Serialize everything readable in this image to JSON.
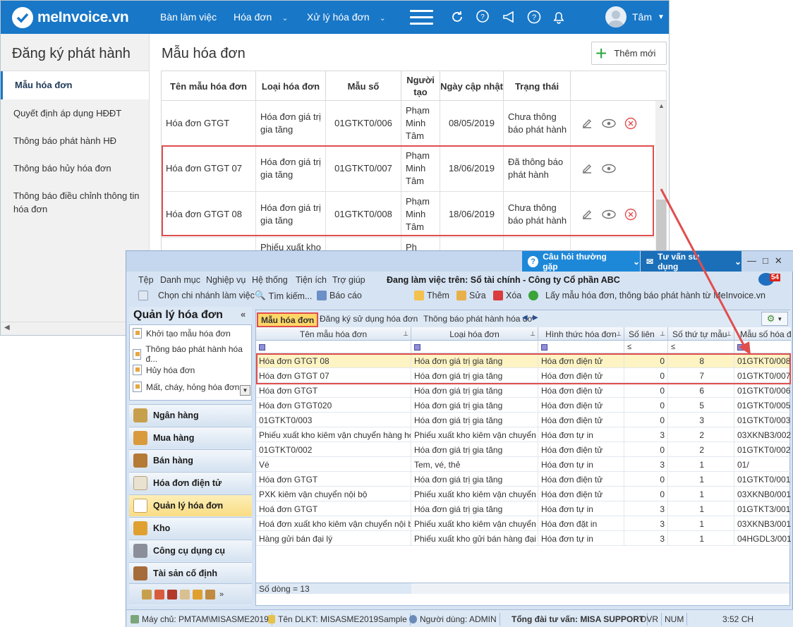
{
  "web": {
    "logo_text": "meInvoice.vn",
    "nav": [
      "Bàn làm việc",
      "Hóa đơn",
      "Xử lý hóa đơn"
    ],
    "user": "Tâm",
    "sidebar": {
      "title": "Đăng ký phát hành",
      "items": [
        "Mẫu hóa đơn",
        "Quyết định áp dụng HĐĐT",
        "Thông báo phát hành HĐ",
        "Thông báo hủy hóa đơn",
        "Thông báo điều chỉnh thông tin hóa đơn"
      ]
    },
    "page_title": "Mẫu hóa đơn",
    "add_button": "Thêm mới",
    "table": {
      "headers": [
        "Tên mẫu hóa đơn",
        "Loại hóa đơn",
        "Mẫu số",
        "Người tạo",
        "Ngày cập nhật",
        "Trạng thái"
      ],
      "rows": [
        {
          "name": "Hóa đơn GTGT",
          "type": "Hóa đơn giá trị gia tăng",
          "code": "01GTKT0/006",
          "creator": "Phạm Minh Tâm",
          "date": "08/05/2019",
          "status": "Chưa thông báo phát hành"
        },
        {
          "name": "Hóa đơn GTGT 07",
          "type": "Hóa đơn giá trị gia tăng",
          "code": "01GTKT0/007",
          "creator": "Phạm Minh Tâm",
          "date": "18/06/2019",
          "status": "Đã thông báo phát hành"
        },
        {
          "name": "Hóa đơn GTGT 08",
          "type": "Hóa đơn giá trị gia tăng",
          "code": "01GTKT0/008",
          "creator": "Phạm Minh Tâm",
          "date": "18/06/2019",
          "status": "Chưa thông báo phát hành"
        },
        {
          "name": "",
          "type": "Phiếu xuất kho",
          "code": "",
          "creator": "Ph",
          "date": "",
          "status": ""
        }
      ]
    }
  },
  "desktop": {
    "faq": "Câu hỏi thường gặp",
    "support": "Tư vấn sử dụng",
    "menu": [
      "Tệp",
      "Danh mục",
      "Nghiệp vụ",
      "Hệ thống",
      "Tiện ích",
      "Trợ giúp"
    ],
    "working_on": "Đang làm việc trên: Sổ tài chính - Công ty Cổ phần ABC",
    "badge": "54",
    "toolbar": [
      "Chọn chi nhánh làm việc",
      "Tìm kiếm...",
      "Báo cáo",
      "Thêm",
      "Sửa",
      "Xóa",
      "Lấy mẫu hóa đơn, thông báo phát hành từ MeInvoice.vn"
    ],
    "left_title": "Quản lý hóa đơn",
    "left_list": [
      "Khởi tạo mẫu hóa đơn",
      "Thông báo phát hành hóa đ...",
      "Hủy hóa đơn",
      "Mất, cháy, hỏng hóa đơn"
    ],
    "modules": [
      "Ngân hàng",
      "Mua hàng",
      "Bán hàng",
      "Hóa đơn điện tử",
      "Quản lý hóa đơn",
      "Kho",
      "Công cụ dụng cụ",
      "Tài sản cố định"
    ],
    "tabs": [
      "Mẫu hóa đơn",
      "Đăng ký sử dụng hóa đơn",
      "Thông báo phát hành hóa đơ"
    ],
    "grid_headers": [
      "Tên mẫu hóa đơn",
      "Loại hóa đơn",
      "Hình thức hóa đơn",
      "Số liên",
      "Số thứ tự mẫu",
      "Mẫu số hóa đơ"
    ],
    "filter_ops": [
      "≤",
      "≤"
    ],
    "grid_rows": [
      [
        "Hóa đơn GTGT 08",
        "Hóa đơn giá trị gia tăng",
        "Hóa đơn điện tử",
        "0",
        "8",
        "01GTKT0/008"
      ],
      [
        "Hóa đơn GTGT 07",
        "Hóa đơn giá trị gia tăng",
        "Hóa đơn điện tử",
        "0",
        "7",
        "01GTKT0/007"
      ],
      [
        "Hóa đơn GTGT",
        "Hóa đơn giá trị gia tăng",
        "Hóa đơn điện tử",
        "0",
        "6",
        "01GTKT0/006"
      ],
      [
        "Hóa đơn GTGT020",
        "Hóa đơn giá trị gia tăng",
        "Hóa đơn điện tử",
        "0",
        "5",
        "01GTKT0/005"
      ],
      [
        "01GTKT0/003",
        "Hóa đơn giá trị gia tăng",
        "Hóa đơn điện tử",
        "0",
        "3",
        "01GTKT0/003"
      ],
      [
        "Phiếu xuất kho kiêm vận chuyển hàng hó",
        "Phiếu xuất kho kiêm vận chuyển",
        "Hóa đơn tự in",
        "3",
        "2",
        "03XKNB3/002"
      ],
      [
        "01GTKT0/002",
        "Hóa đơn giá trị gia tăng",
        "Hóa đơn điện tử",
        "0",
        "2",
        "01GTKT0/002"
      ],
      [
        "Vé",
        "Tem, vé, thẻ",
        "Hóa đơn tự in",
        "3",
        "1",
        "01/"
      ],
      [
        "Hóa đơn GTGT",
        "Hóa đơn giá trị gia tăng",
        "Hóa đơn điện tử",
        "0",
        "1",
        "01GTKT0/001"
      ],
      [
        "PXK kiêm vận chuyển nội bộ",
        "Phiếu xuất kho kiêm vận chuyển",
        "Hóa đơn điện tử",
        "0",
        "1",
        "03XKNB0/001"
      ],
      [
        "Hoá đơn GTGT",
        "Hóa đơn giá trị gia tăng",
        "Hóa đơn tự in",
        "3",
        "1",
        "01GTKT3/001"
      ],
      [
        "Hoá đơn xuất kho kiêm vận chuyển nội bộ",
        "Phiếu xuất kho kiêm vận chuyển",
        "Hóa đơn đặt in",
        "3",
        "1",
        "03XKNB3/001"
      ],
      [
        "Hàng gửi bán đại lý",
        "Phiếu xuất kho gửi bán hàng đại l",
        "Hóa đơn tự in",
        "3",
        "1",
        "04HGDL3/001"
      ]
    ],
    "row_count": "Số dòng = 13",
    "status": [
      "Máy chủ: PMTAM\\MISASME2019",
      "Tên DLKT: MISASME2019Sample",
      "Người dùng: ADMIN",
      "Tổng đài tư vấn: MISA SUPPORT",
      "OVR",
      "NUM",
      "3:52 CH"
    ]
  }
}
